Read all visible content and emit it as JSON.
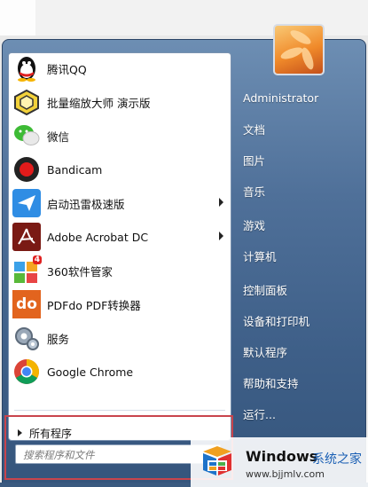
{
  "programs": [
    {
      "label": "腾讯QQ",
      "icon": "qq-penguin-icon",
      "submenu": false
    },
    {
      "label": "批量缩放大师 演示版",
      "icon": "cube-icon",
      "submenu": false
    },
    {
      "label": "微信",
      "icon": "wechat-icon",
      "submenu": false
    },
    {
      "label": "Bandicam",
      "icon": "record-icon",
      "submenu": false
    },
    {
      "label": "启动迅雷极速版",
      "icon": "bird-icon",
      "submenu": true
    },
    {
      "label": "Adobe Acrobat DC",
      "icon": "acrobat-icon",
      "submenu": true
    },
    {
      "label": "360软件管家",
      "icon": "grid-icon",
      "submenu": false
    },
    {
      "label": "PDFdo PDF转换器",
      "icon": "do-icon",
      "submenu": false
    },
    {
      "label": "服务",
      "icon": "gears-icon",
      "submenu": false
    },
    {
      "label": "Google Chrome",
      "icon": "chrome-icon",
      "submenu": false
    }
  ],
  "all_programs": "所有程序",
  "search_placeholder": "搜索程序和文件",
  "right_items": [
    "Administrator",
    "文档",
    "图片",
    "音乐",
    "游戏",
    "计算机",
    "控制面板",
    "设备和打印机",
    "默认程序",
    "帮助和支持",
    "运行..."
  ],
  "badges": {
    "grid_badge": "4",
    "do_text": "do"
  },
  "watermark": {
    "title": "Windows",
    "cn": "系统之家",
    "url": "www.bjjmlv.com"
  },
  "colors": {
    "highlight": "#c9444c",
    "menu_blue": "#4f7099"
  }
}
